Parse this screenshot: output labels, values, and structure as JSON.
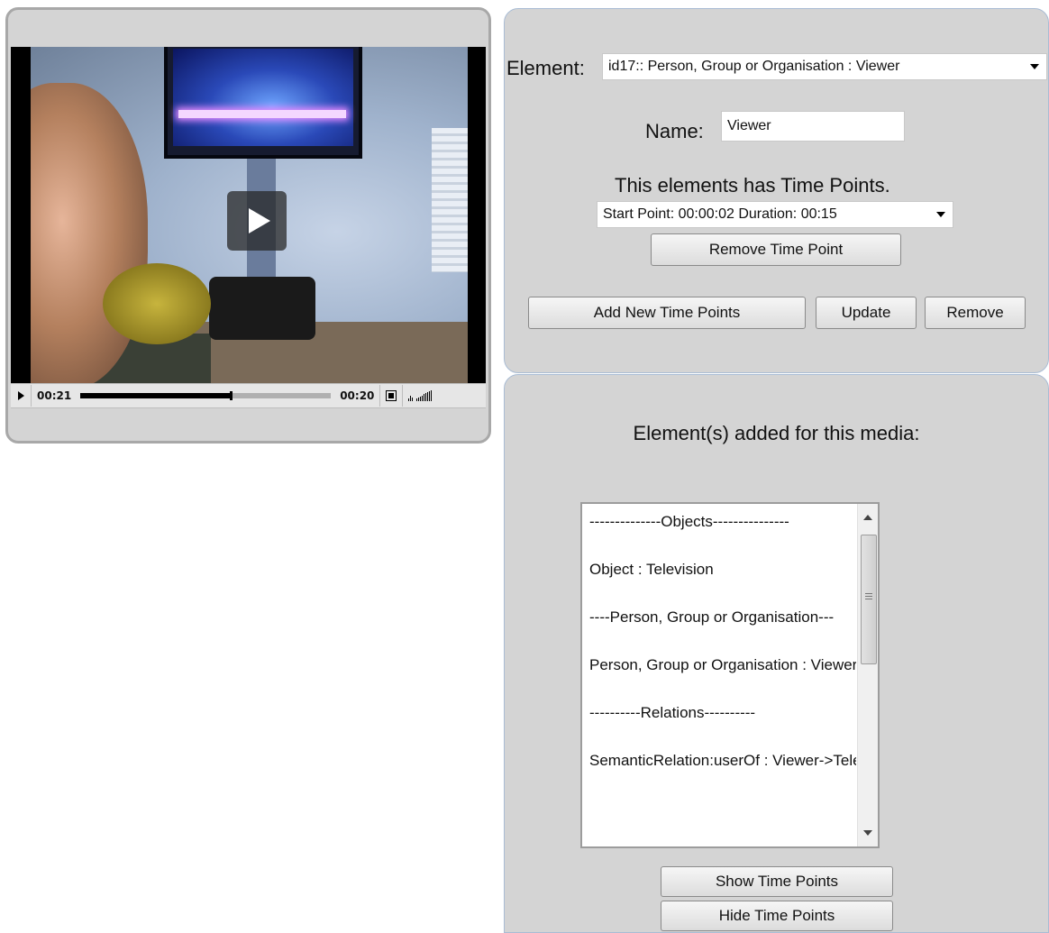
{
  "player": {
    "time_elapsed": "00:21",
    "time_remaining": "00:20",
    "progress": 0.6
  },
  "editor": {
    "element_label": "Element:",
    "element_value": "id17:: Person, Group or Organisation : Viewer",
    "name_label": "Name:",
    "name_value": "Viewer",
    "timepoints_message": "This elements has Time Points.",
    "timepoint_value": "Start Point: 00:00:02 Duration: 00:15",
    "remove_timepoint_button": "Remove Time Point",
    "add_timepoints_button": "Add New Time Points",
    "update_button": "Update",
    "remove_button": "Remove"
  },
  "elements_list": {
    "heading": "Element(s) added for this media:",
    "items": [
      "--------------Objects---------------",
      "Object : Television",
      "----Person, Group or Organisation---",
      "Person, Group or Organisation : Viewer",
      "----------Relations----------",
      "SemanticRelation:userOf : Viewer->Television"
    ],
    "show_button": "Show Time Points",
    "hide_button": "Hide Time Points"
  }
}
